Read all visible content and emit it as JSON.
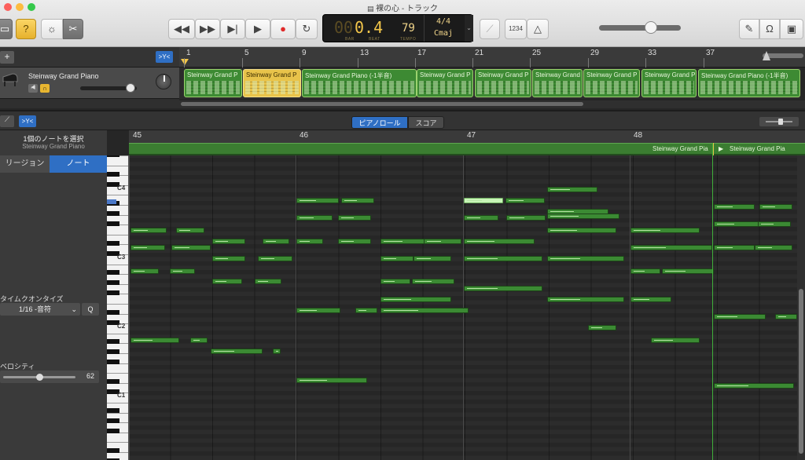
{
  "window": {
    "title": "裸の心 - トラック"
  },
  "transport": {
    "position": "0.4",
    "position_prefix": "00",
    "bar_cap": "BAR",
    "beat_cap": "BEAT",
    "tempo": "79",
    "tempo_cap": "TEMPO",
    "time_signature": "4/4",
    "key": "Cmaj",
    "count_in": "1234"
  },
  "tracks": {
    "track_name": "Steinway Grand Piano",
    "ruler_numbers": [
      "1",
      "5",
      "9",
      "13",
      "17",
      "21",
      "25",
      "29",
      "33",
      "37"
    ],
    "regions": [
      {
        "label": "Steinway Grand P",
        "selected": false
      },
      {
        "label": "Steinway Grand P",
        "selected": true
      },
      {
        "label": "Steinway Grand Piano (-1半音)",
        "selected": false
      },
      {
        "label": "Steinway Grand P",
        "selected": false
      },
      {
        "label": "Steinway Grand P",
        "selected": false
      },
      {
        "label": "Steinway Grand P",
        "selected": false
      },
      {
        "label": "Steinway Grand P",
        "selected": false
      },
      {
        "label": "Steinway Grand P",
        "selected": false
      },
      {
        "label": "Steinway Grand Piano (-1半音)",
        "selected": false
      }
    ]
  },
  "editor": {
    "tab_piano_roll": "ピアノロール",
    "tab_score": "スコア",
    "bar_numbers": [
      "45",
      "46",
      "47",
      "48"
    ],
    "region_label_1": "Steinway Grand Pia",
    "region_label_2": "Steinway Grand Pia",
    "key_labels": [
      "C4",
      "C3",
      "C2",
      "C1"
    ]
  },
  "inspector": {
    "selection_title": "1個のノートを選択",
    "selection_subtitle": "Steinway Grand Piano",
    "tab_region": "リージョン",
    "tab_note": "ノート",
    "quantize_label": "タイムクオンタイズ",
    "quantize_value": "1/16 -音符",
    "quantize_button": "Q",
    "velocity_label": "ベロシティ",
    "velocity_value": "62"
  },
  "colors": {
    "note_green": "#3b8a33",
    "selected_region": "#e8c34a",
    "accent_blue": "#2f6fc4",
    "lcd_text": "#f3c64a"
  }
}
